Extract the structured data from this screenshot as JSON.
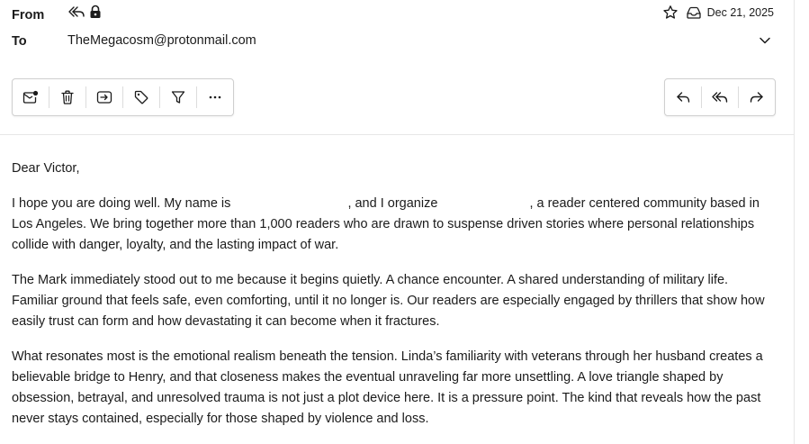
{
  "header": {
    "from_label": "From",
    "to_label": "To",
    "to_value": "TheMegacosm@protonmail.com",
    "date": "Dec 21, 2025"
  },
  "icons": {
    "reply_all_indicator": "reply-all-icon",
    "lock": "lock-icon",
    "star": "star-icon",
    "inbox": "inbox-icon",
    "expand": "chevron-down-icon"
  },
  "toolbar_left": [
    {
      "name": "mark-unread-icon"
    },
    {
      "name": "trash-icon"
    },
    {
      "name": "move-icon"
    },
    {
      "name": "label-icon"
    },
    {
      "name": "filter-icon"
    },
    {
      "name": "more-icon"
    }
  ],
  "toolbar_right": [
    {
      "name": "reply-icon"
    },
    {
      "name": "reply-all-icon"
    },
    {
      "name": "forward-icon"
    }
  ],
  "message": {
    "greeting": "Dear Victor,",
    "p1_a": "I hope you are doing well. My name is ",
    "p1_b": ", and I organize ",
    "p1_c": ", a reader centered community based in Los Angeles. We bring together more than 1,000 readers who are drawn to suspense driven stories where personal relationships collide with danger, loyalty, and the lasting impact of war.",
    "p2": "The Mark immediately stood out to me because it begins quietly. A chance encounter. A shared understanding of military life. Familiar ground that feels safe, even comforting, until it no longer is. Our readers are especially engaged by thrillers that show how easily trust can form and how devastating it can become when it fractures.",
    "p3": "What resonates most is the emotional realism beneath the tension. Linda’s familiarity with veterans through her husband creates a believable bridge to Henry, and that closeness makes the eventual unraveling far more unsettling. A love triangle shaped by obsession, betrayal, and unresolved trauma is not just a plot device here. It is a pressure point. The kind that reveals how the past never stays contained, especially for those shaped by violence and loss."
  },
  "colors": {
    "text": "#1b1b1b",
    "border": "#cfcfcf",
    "divider": "#e6e6e6"
  }
}
